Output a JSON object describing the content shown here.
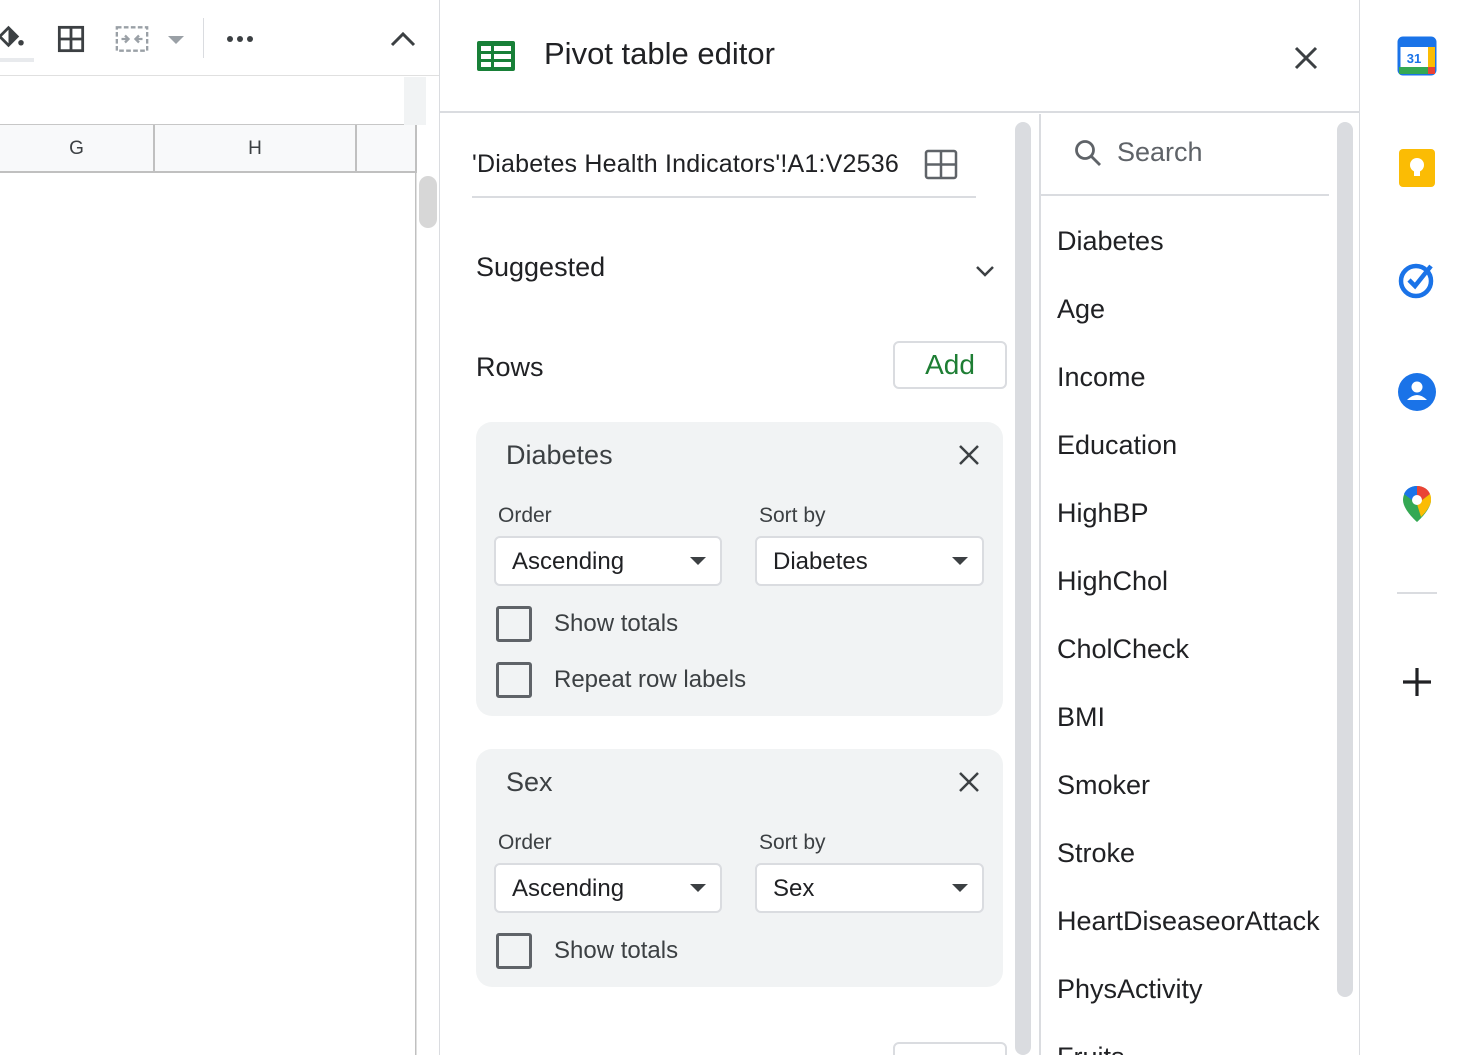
{
  "sheet": {
    "columns": [
      "G",
      "H"
    ],
    "toolbar_icons": [
      "paint-format-icon",
      "borders-icon",
      "merge-cells-icon",
      "dropdown-arrow-icon",
      "more-options-icon",
      "collapse-toolbar-icon"
    ]
  },
  "editor": {
    "title": "Pivot table editor",
    "range": "'Diabetes Health Indicators'!A1:V2536",
    "suggested_label": "Suggested",
    "rows_label": "Rows",
    "add_label": "Add",
    "row_fields": [
      {
        "name": "Diabetes",
        "order_label": "Order",
        "order_value": "Ascending",
        "sortby_label": "Sort by",
        "sortby_value": "Diabetes",
        "checkboxes": [
          {
            "label": "Show totals",
            "checked": false
          },
          {
            "label": "Repeat row labels",
            "checked": false
          }
        ]
      },
      {
        "name": "Sex",
        "order_label": "Order",
        "order_value": "Ascending",
        "sortby_label": "Sort by",
        "sortby_value": "Sex",
        "checkboxes": [
          {
            "label": "Show totals",
            "checked": false
          }
        ]
      }
    ]
  },
  "field_list": {
    "search_placeholder": "Search",
    "fields": [
      "Diabetes",
      "Age",
      "Income",
      "Education",
      "HighBP",
      "HighChol",
      "CholCheck",
      "BMI",
      "Smoker",
      "Stroke",
      "HeartDiseaseorAttack",
      "PhysActivity",
      "Fruits"
    ]
  },
  "rail": {
    "calendar_day": "31",
    "icons": [
      "calendar-icon",
      "keep-icon",
      "tasks-icon",
      "contacts-icon",
      "maps-icon",
      "add-icon"
    ]
  },
  "colors": {
    "accent_green": "#1e7e34",
    "sheets_green": "#188038",
    "card_bg": "#f1f3f4",
    "divider": "#dadce0"
  }
}
